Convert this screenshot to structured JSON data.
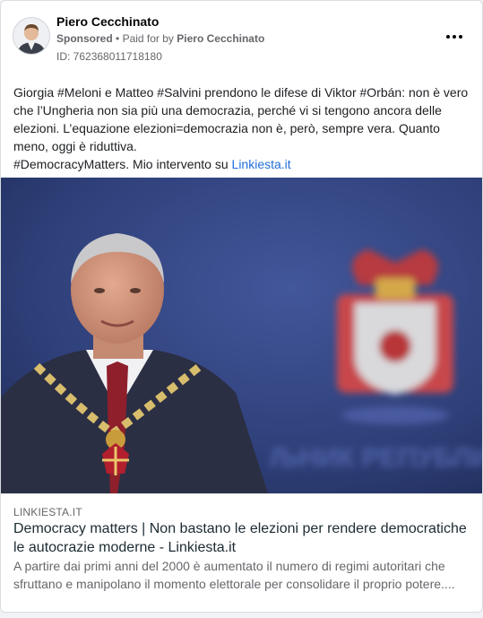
{
  "post": {
    "author": "Piero Cecchinato",
    "sponsored_label": "Sponsored",
    "separator": "•",
    "paid_for_prefix": "Paid for by",
    "paid_for_name": "Piero Cecchinato",
    "ad_id": "ID: 762368011718180",
    "text_main": "Giorgia #Meloni e Matteo #Salvini prendono le difese di Viktor #Orbán: non è vero che l’Ungheria non sia più una democrazia, perché vi si tengono ancora delle elezioni. L’equazione elezioni=democrazia non è, però, sempre vera. Quanto meno, oggi è riduttiva.",
    "text_tail": "#DemocracyMatters. Mio intervento su",
    "text_link": "Linkiesta.it",
    "more_icon": "ellipsis-icon"
  },
  "media": {
    "background_sign_text": "ЉНИК РЕПУБЛИ"
  },
  "link_preview": {
    "domain": "LINKIESTA.IT",
    "title": "Democracy matters | Non bastano le elezioni per rendere democratiche le autocrazie moderne - Linkiesta.it",
    "description": "A partire dai primi anni del 2000 è aumentato il numero di regimi autoritari che sfruttano e manipolano il momento elettorale per consolidare il proprio potere...."
  },
  "colors": {
    "link_blue": "#216fdb",
    "muted_gray": "#65676b",
    "photo_background": "#2e3f78"
  }
}
